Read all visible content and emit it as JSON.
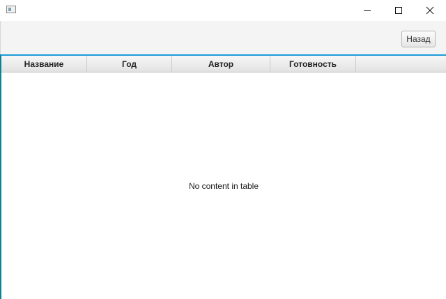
{
  "window": {
    "icons": {
      "app": "app-window-icon",
      "minimize": "minimize-icon",
      "maximize": "maximize-icon",
      "close": "close-icon"
    }
  },
  "toolbar": {
    "back_label": "Назад"
  },
  "table": {
    "columns": [
      "Название",
      "Год",
      "Автор",
      "Готовность"
    ],
    "rows": [],
    "empty_text": "No content in table"
  },
  "colors": {
    "accent_focus": "#1b9bd8",
    "left_border": "#0b8296",
    "toolbar_bg": "#f4f4f4"
  }
}
